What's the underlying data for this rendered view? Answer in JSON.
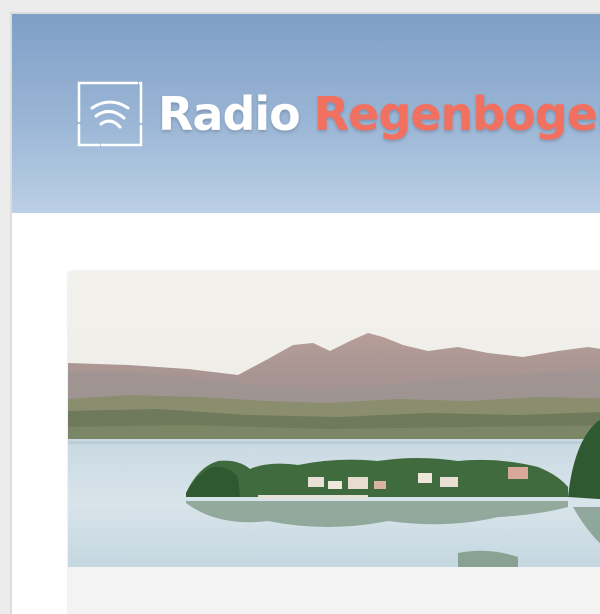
{
  "header": {
    "logo_icon": "radio-waves-icon",
    "title_part_1": "Radio",
    "title_part_2": "Regenbogen",
    "colors": {
      "header_top": "#7f9fc6",
      "header_bottom": "#bcd0e6",
      "title_primary": "#ffffff",
      "title_accent": "#f2705f"
    }
  },
  "main": {
    "hero": {
      "image": "lake-landscape-image"
    }
  }
}
